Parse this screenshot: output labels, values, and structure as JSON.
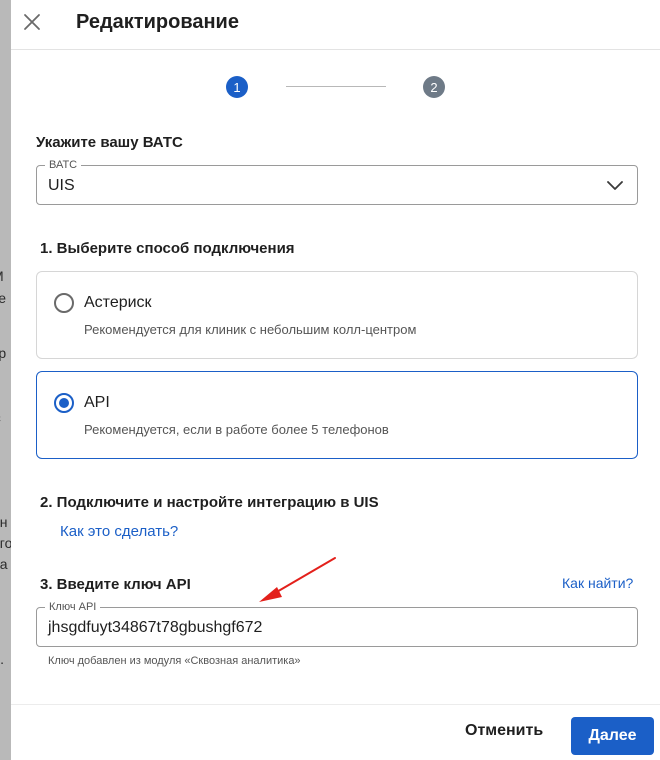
{
  "background": {
    "fragments": [
      "М",
      "зе",
      "зр",
      "е",
      "с",
      "он",
      "его",
      "ба",
      "л."
    ]
  },
  "header": {
    "title": "Редактирование"
  },
  "stepper": {
    "steps": [
      "1",
      "2"
    ],
    "current": 1
  },
  "pbx": {
    "heading": "Укажите вашу ВАТС",
    "field_label": "ВАТС",
    "value": "UIS"
  },
  "connection": {
    "heading": "1. Выберите способ подключения",
    "options": [
      {
        "title": "Астериск",
        "description": "Рекомендуется для клиник с небольшим колл-центром",
        "selected": false
      },
      {
        "title": "API",
        "description": "Рекомендуется, если в работе более 5 телефонов",
        "selected": true
      }
    ]
  },
  "integration": {
    "heading": "2. Подключите и настройте интеграцию в UIS",
    "link": "Как это сделать?"
  },
  "api_key": {
    "heading": "3. Введите ключ API",
    "find_link": "Как найти?",
    "field_label": "Ключ API",
    "value": "jhsgdfuyt34867t78gbushgf672",
    "helper": "Ключ добавлен из модуля «Сквозная аналитика»"
  },
  "footer": {
    "cancel_label": "Отменить",
    "next_label": "Далее"
  },
  "colors": {
    "accent": "#1b5fc7",
    "annotation_arrow": "#e3201b",
    "step_inactive": "#6e7a87"
  }
}
